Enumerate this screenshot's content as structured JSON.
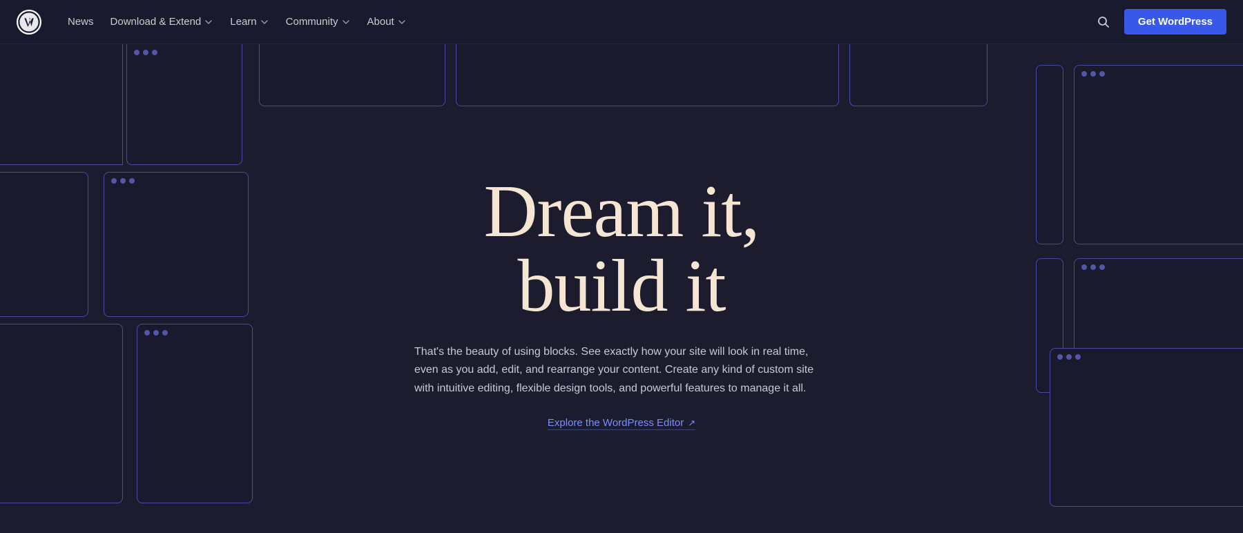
{
  "nav": {
    "logo_alt": "WordPress Logo",
    "links": [
      {
        "id": "news",
        "label": "News",
        "has_dropdown": false
      },
      {
        "id": "download",
        "label": "Download & Extend",
        "has_dropdown": true
      },
      {
        "id": "learn",
        "label": "Learn",
        "has_dropdown": true
      },
      {
        "id": "community",
        "label": "Community",
        "has_dropdown": true
      },
      {
        "id": "about",
        "label": "About",
        "has_dropdown": true
      }
    ],
    "search_label": "Search",
    "cta_label": "Get WordPress"
  },
  "hero": {
    "title_line1": "Dream it,",
    "title_line2": "build it",
    "description": "That's the beauty of using blocks. See exactly how your site will look in real time, even as you add, edit, and rearrange your content. Create any kind of custom site with intuitive editing, flexible design tools, and powerful features to manage it all.",
    "explore_label": "Explore the WordPress Editor",
    "explore_arrow": "↗"
  },
  "colors": {
    "accent_blue": "#3858e9",
    "card_border": "#4a4aaa",
    "card_dot": "#5555aa",
    "hero_bg": "#1c1c2e",
    "nav_bg": "#1a1a2e",
    "title_color": "#f5e6d3",
    "link_color": "#7a8fff"
  }
}
